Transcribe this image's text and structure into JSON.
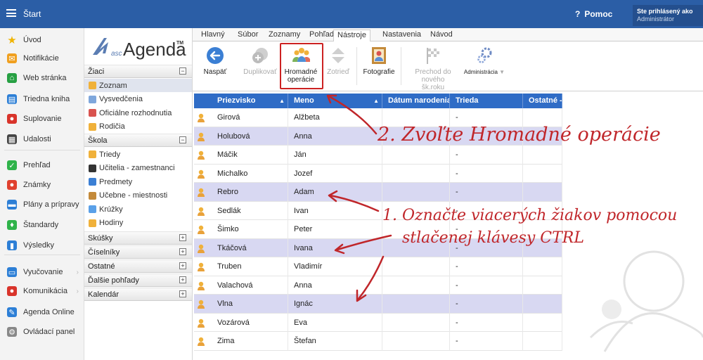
{
  "topbar": {
    "title": "Štart",
    "help_label": "Pomoc",
    "help_glyph": "?",
    "user_line1": "Ste prihlásený ako",
    "user_line2": "Administrátor"
  },
  "leftnav": {
    "items": [
      {
        "label": "Úvod",
        "icon": "star-icon",
        "color": "#f0b400",
        "glyph": "★"
      },
      {
        "label": "Notifikácie",
        "icon": "mail-icon",
        "color": "#f0a020",
        "glyph": "✉"
      },
      {
        "label": "Web stránka",
        "icon": "home-icon",
        "color": "#27a043",
        "glyph": "⌂"
      },
      {
        "label": "Triedna kniha",
        "icon": "book-icon",
        "color": "#2d7fd6",
        "glyph": "▤"
      },
      {
        "label": "Suplovanie",
        "icon": "person-icon",
        "color": "#d9342b",
        "glyph": "●"
      },
      {
        "label": "Udalosti",
        "icon": "calendar-icon",
        "color": "#444444",
        "glyph": "▦"
      },
      {
        "label": "Prehľad",
        "icon": "check-circle-icon",
        "color": "#2fb34a",
        "glyph": "✓"
      },
      {
        "label": "Známky",
        "icon": "grade-icon",
        "color": "#e0412f",
        "glyph": "●"
      },
      {
        "label": "Plány a prípravy",
        "icon": "briefcase-icon",
        "color": "#2d7fd6",
        "glyph": "▬"
      },
      {
        "label": "Štandardy",
        "icon": "shield-icon",
        "color": "#2fb34a",
        "glyph": "♦"
      },
      {
        "label": "Výsledky",
        "icon": "bar-chart-icon",
        "color": "#2d7fd6",
        "glyph": "▮"
      },
      {
        "label": "Vyučovanie",
        "icon": "classroom-icon",
        "color": "#2d7fd6",
        "glyph": "▭",
        "arrow": "›"
      },
      {
        "label": "Komunikácia",
        "icon": "chat-icon",
        "color": "#d9342b",
        "glyph": "●",
        "arrow": "›"
      },
      {
        "label": "Agenda Online",
        "icon": "pen-icon",
        "color": "#2d7fd6",
        "glyph": "✎"
      },
      {
        "label": "Ovládací panel",
        "icon": "gear-icon",
        "color": "#888888",
        "glyph": "⚙"
      }
    ]
  },
  "logo": {
    "prefix": "asc",
    "name": "Agenda",
    "tm": "TM"
  },
  "midpanel": {
    "sections": [
      {
        "title": "Žiaci",
        "toggle": "−",
        "items": [
          "Zoznam",
          "Vysvedčenia",
          "Oficiálne rozhodnutia",
          "Rodičia"
        ]
      },
      {
        "title": "Škola",
        "toggle": "−",
        "items": [
          "Triedy",
          "Učitelia - zamestnanci",
          "Predmety",
          "Učebne - miestnosti",
          "Krúžky",
          "Hodiny"
        ]
      },
      {
        "title": "Skúšky",
        "toggle": "+"
      },
      {
        "title": "Číselníky",
        "toggle": "+"
      },
      {
        "title": "Ostatné",
        "toggle": "+"
      },
      {
        "title": "Ďalšie pohľady",
        "toggle": "+"
      },
      {
        "title": "Kalendár",
        "toggle": "+"
      }
    ]
  },
  "tabs": [
    "Hlavný",
    "Súbor",
    "Zoznamy",
    "Pohľad",
    "Nástroje",
    "Nastavenia",
    "Návod"
  ],
  "active_tab": "Nástroje",
  "ribbon": {
    "back": "Naspäť",
    "duplicate": "Duplikovať",
    "bulk_l1": "Hromadné",
    "bulk_l2": "operácie",
    "sort": "Zotrieď",
    "photos": "Fotografie",
    "next_year_l1": "Prechod do",
    "next_year_l2": "nového šk.roku",
    "admin": "Administrácia"
  },
  "grid": {
    "columns": [
      "Priezvisko",
      "Meno",
      "Dátum narodenia",
      "Trieda",
      "Ostatné - I"
    ],
    "sort_glyph": "▲",
    "rows": [
      {
        "last": "Girová",
        "first": "Alžbeta",
        "dob": "",
        "class": "-",
        "selected": false
      },
      {
        "last": "Holubová",
        "first": "Anna",
        "dob": "",
        "class": "-",
        "selected": true
      },
      {
        "last": "Máčik",
        "first": "Ján",
        "dob": "",
        "class": "-",
        "selected": false
      },
      {
        "last": "Michalko",
        "first": "Jozef",
        "dob": "",
        "class": "-",
        "selected": false
      },
      {
        "last": "Rebro",
        "first": "Adam",
        "dob": "",
        "class": "-",
        "selected": true
      },
      {
        "last": "Sedlák",
        "first": "Ivan",
        "dob": "",
        "class": "-",
        "selected": false
      },
      {
        "last": "Šimko",
        "first": "Peter",
        "dob": "",
        "class": "-",
        "selected": false
      },
      {
        "last": "Tkáčová",
        "first": "Ivana",
        "dob": "",
        "class": "-",
        "selected": true
      },
      {
        "last": "Truben",
        "first": "Vladimír",
        "dob": "",
        "class": "-",
        "selected": false
      },
      {
        "last": "Valachová",
        "first": "Anna",
        "dob": "",
        "class": "-",
        "selected": false
      },
      {
        "last": "Vlna",
        "first": "Ignác",
        "dob": "",
        "class": "-",
        "selected": true
      },
      {
        "last": "Vozárová",
        "first": "Eva",
        "dob": "",
        "class": "-",
        "selected": false
      },
      {
        "last": "Zima",
        "first": "Štefan",
        "dob": "",
        "class": "-",
        "selected": false
      }
    ]
  },
  "annotations": {
    "step2": "2. Zvoľte Hromadné operácie",
    "step1_l1": "1. Označte viacerých žiakov pomocou",
    "step1_l2": "stlačenej klávesy CTRL",
    "color": "#c0262a"
  }
}
